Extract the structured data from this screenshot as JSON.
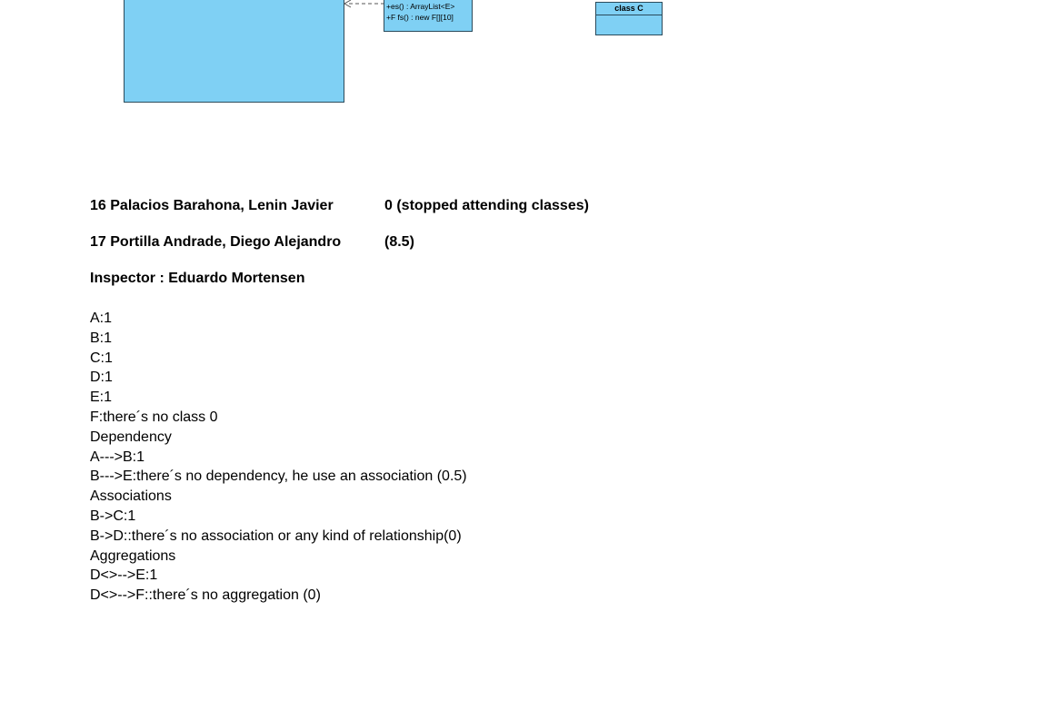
{
  "diagram": {
    "methods": [
      "+es() : ArrayList<E>",
      "+F fs() : new F[][10]"
    ],
    "class_c": "class C"
  },
  "students": [
    {
      "label": "16 Palacios Barahona, Lenin Javier",
      "score": "0 (stopped attending classes)"
    },
    {
      "label": "17 Portilla Andrade, Diego Alejandro",
      "score": "(8.5)"
    }
  ],
  "inspector": "Inspector : Eduardo Mortensen",
  "evaluation": [
    "A:1",
    "B:1",
    "C:1",
    "D:1",
    "E:1",
    "F:there´s no class 0",
    "Dependency",
    "A--->B:1",
    "B--->E:there´s no dependency, he use an association (0.5)",
    "Associations",
    "B->C:1",
    "B->D::there´s no association or any kind of relationship(0)",
    "Aggregations",
    "D<>-->E:1",
    "D<>-->F::there´s no aggregation (0)"
  ]
}
